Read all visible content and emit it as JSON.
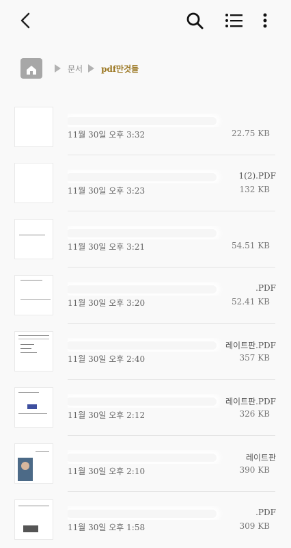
{
  "toolbar": {
    "back": "back-arrow-icon",
    "search": "search-icon",
    "list": "list-view-icon",
    "more": "more-vertical-icon"
  },
  "breadcrumb": {
    "home": "home-folder-icon",
    "level1": "문서",
    "current": "pdf만것들"
  },
  "files": [
    {
      "name": "",
      "date": "11월 30일 오후 3:32",
      "size": "22.75 KB"
    },
    {
      "name": "1(2).PDF",
      "date": "11월 30일 오후 3:23",
      "size": "132 KB"
    },
    {
      "name": "",
      "date": "11월 30일 오후 3:21",
      "size": "54.51 KB"
    },
    {
      "name": ".PDF",
      "date": "11월 30일 오후 3:20",
      "size": "52.41 KB"
    },
    {
      "name": "레이트판.PDF",
      "date": "11월 30일 오후 2:40",
      "size": "357 KB"
    },
    {
      "name": "레이트판.PDF",
      "date": "11월 30일 오후 2:12",
      "size": "326 KB"
    },
    {
      "name": "레이트판",
      "date": "11월 30일 오후 2:10",
      "size": "390 KB"
    },
    {
      "name": ".PDF",
      "date": "11월 30일 오후 1:58",
      "size": "309 KB"
    }
  ],
  "colors": {
    "background": "#f9f9f9",
    "breadcrumb_current": "#9a7620",
    "divider": "#e4e4e4"
  }
}
